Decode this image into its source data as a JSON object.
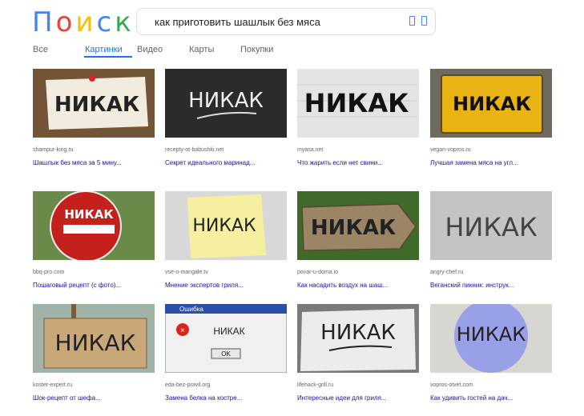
{
  "logo": {
    "letters": [
      "П",
      "о",
      "и",
      "с",
      "к"
    ],
    "colors": [
      "#4285f4",
      "#ea4335",
      "#fbbc05",
      "#4285f4",
      "#34a853"
    ]
  },
  "search": {
    "query": "как приготовить шашлык без мяса"
  },
  "tabs": [
    {
      "label": "Все"
    },
    {
      "label": "Картинки"
    },
    {
      "label": "Видео"
    },
    {
      "label": "Карты"
    },
    {
      "label": "Покупки"
    }
  ],
  "results": [
    {
      "source": "shampur-king.ru",
      "title": "Шашлык без мяса за 5 мину...",
      "sign": "НИКАК",
      "style": "torn-paper"
    },
    {
      "source": "recepty-ot-babushki.net",
      "title": "Секрет идеального маринад...",
      "sign": "НИКАК",
      "style": "chalkboard"
    },
    {
      "source": "myasa.net",
      "title": "Что жарить если нет свини...",
      "sign": "НИКАК",
      "style": "graffiti-wall"
    },
    {
      "source": "vegan-vopros.ru",
      "title": "Лучшая замена мяса на угл...",
      "sign": "НИКАК",
      "style": "yellow-sign"
    },
    {
      "source": "bbq-pro.com",
      "title": "Пошаговый рецепт (с фото)...",
      "sign": "НИКАК",
      "style": "stop-sign"
    },
    {
      "source": "vse-o-mangale.tv",
      "title": "Мнение экспертов гриля...",
      "sign": "НИКАК",
      "style": "sticky-note"
    },
    {
      "source": "povar-u-doma.io",
      "title": "Как насадить воздух на шаш...",
      "sign": "НИКАК",
      "style": "wood-arrow"
    },
    {
      "source": "angry-chef.ru",
      "title": "Веганский пикник: инструк...",
      "sign": "НИКАК",
      "style": "concrete"
    },
    {
      "source": "koster-expert.ru",
      "title": "Шок-рецепт от шефа...",
      "sign": "НИКАК",
      "style": "cardboard-sign"
    },
    {
      "source": "eda-bez-pravil.org",
      "title": "Замена белка на костре...",
      "sign": "НИКАК",
      "style": "error-dialog",
      "dialog_title": "Ошибка",
      "dialog_button": "OK"
    },
    {
      "source": "lifehack-grill.ru",
      "title": "Интересные идеи для гриля...",
      "sign": "НИКАК",
      "style": "sketch-paper"
    },
    {
      "source": "vopros-otvet.com",
      "title": "Как удивить гостей на дач...",
      "sign": "НИКАК",
      "style": "balloon"
    }
  ]
}
